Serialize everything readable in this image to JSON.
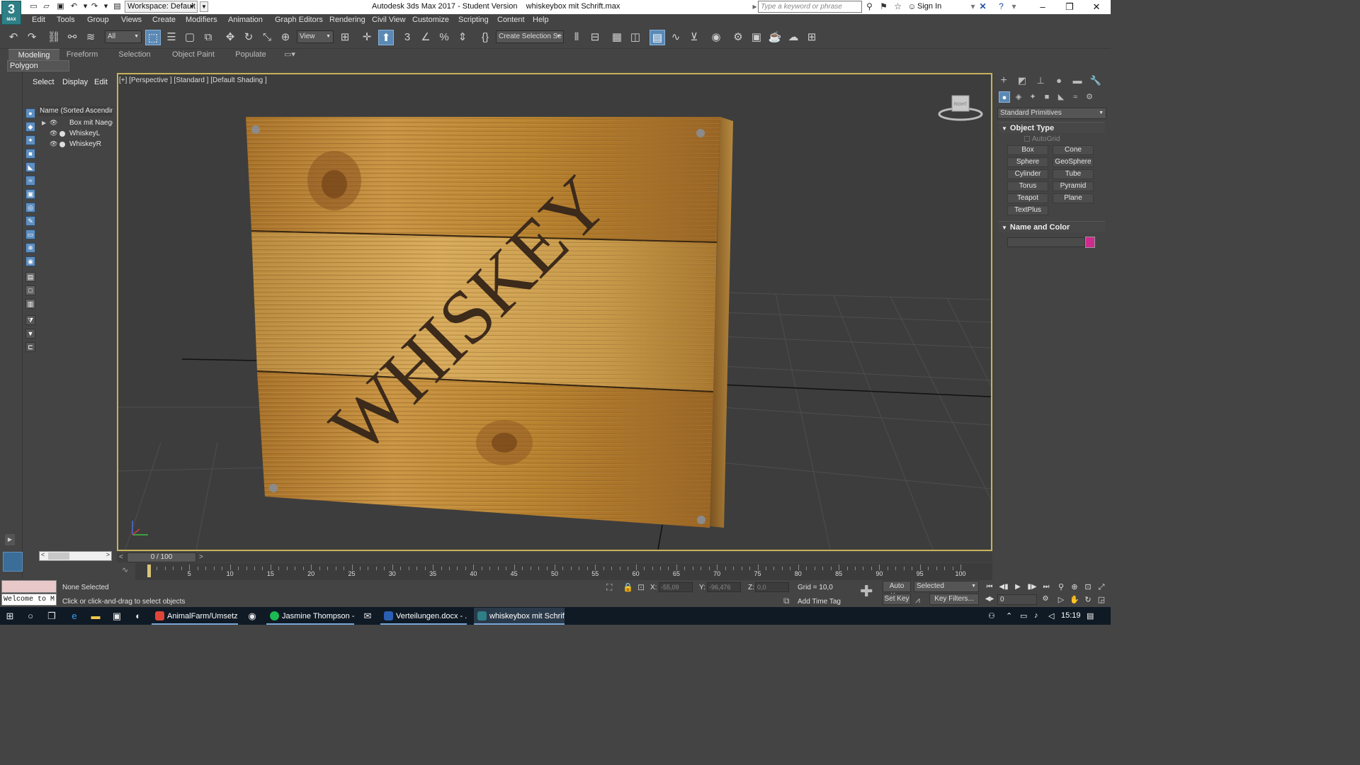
{
  "titlebar": {
    "logo_big": "3",
    "logo_small": "MAX",
    "workspace": "Workspace: Default",
    "title": "Autodesk 3ds Max 2017 - Student Version    whiskeybox mit Schrift.max",
    "search_placeholder": "Type a keyword or phrase",
    "sign_in": "Sign In",
    "min_icon": "–",
    "max_icon": "❐",
    "close_icon": "✕"
  },
  "menu": [
    "Edit",
    "Tools",
    "Group",
    "Views",
    "Create",
    "Modifiers",
    "Animation",
    "Graph Editors",
    "Rendering",
    "Civil View",
    "Customize",
    "Scripting",
    "Content",
    "Help"
  ],
  "toolbar": {
    "filter_select": "All",
    "ref_coord": "View",
    "selection_set": "Create Selection Se"
  },
  "ribbon": {
    "tabs": [
      "Modeling",
      "Freeform",
      "Selection",
      "Object Paint",
      "Populate"
    ],
    "sub": "Polygon Modeling"
  },
  "explorer": {
    "tabs": [
      "Select",
      "Display",
      "Edit"
    ],
    "header": "Name (Sorted Ascending)",
    "items": [
      "Box mit Naegeln",
      "WhiskeyL",
      "WhiskeyR"
    ]
  },
  "viewport": {
    "label": "[+] [Perspective ] [Standard ] [Default Shading ]",
    "crate_text": "WHISKEY",
    "viewcube_label": "RIGHT"
  },
  "command_panel": {
    "category": "Standard Primitives",
    "object_type_title": "Object Type",
    "autogrid": "AutoGrid",
    "primitives": [
      "Box",
      "Cone",
      "Sphere",
      "GeoSphere",
      "Cylinder",
      "Tube",
      "Torus",
      "Pyramid",
      "Teapot",
      "Plane",
      "TextPlus"
    ],
    "name_color_title": "Name and Color",
    "swatch_color": "#cf2a8e"
  },
  "timeline": {
    "position": "0 / 100",
    "ticks": [
      "5",
      "10",
      "15",
      "20",
      "25",
      "30",
      "35",
      "40",
      "45",
      "50",
      "55",
      "60",
      "65",
      "70",
      "75",
      "80",
      "85",
      "90",
      "95",
      "100"
    ]
  },
  "status": {
    "maxscript": "Welcome to M",
    "selection": "None Selected",
    "prompt": "Click or click-and-drag to select objects",
    "x_label": "X:",
    "x_value": "-55,09",
    "y_label": "Y:",
    "y_value": "-96,476",
    "z_label": "Z:",
    "z_value": "0,0",
    "grid": "Grid = 10,0",
    "add_time_tag": "Add Time Tag",
    "auto_key": "Auto Key",
    "set_key": "Set Key",
    "key_mode": "Selected",
    "key_filters": "Key Filters...",
    "frame": "0"
  },
  "taskbar": {
    "apps": [
      "AnimalFarm/Umsetz...",
      "Jasmine Thompson - ...",
      "Verteilungen.docx - ...",
      "whiskeybox mit Schrif..."
    ],
    "time": "15:19"
  }
}
